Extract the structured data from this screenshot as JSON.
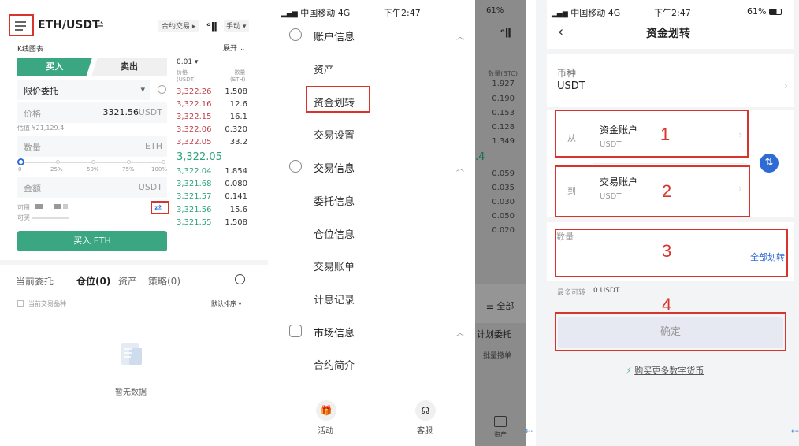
{
  "panel1": {
    "pair": "ETH/USDT",
    "contract_label": "合约交易",
    "manual_label": "手动",
    "kline_label": "K线图表",
    "expand_label": "展开",
    "buy_tab": "买入",
    "sell_tab": "卖出",
    "order_type": "限价委托",
    "price_label": "价格",
    "price_value": "3321.56",
    "price_unit": "USDT",
    "estimate": "估值 ¥21,129.4",
    "qty_label": "数量",
    "qty_unit": "ETH",
    "slider_marks": [
      "0",
      "25%",
      "50%",
      "75%",
      "100%"
    ],
    "amount_label": "金额",
    "amount_unit": "USDT",
    "available_label": "可用",
    "buyable_label": "可买",
    "buy_button": "买入 ETH",
    "ob_precision": "0.01",
    "ob_price_header": "价格\n(USDT)",
    "ob_qty_header": "数量\n(ETH)",
    "asks": [
      {
        "p": "3,322.26",
        "q": "1.508"
      },
      {
        "p": "3,322.16",
        "q": "12.6"
      },
      {
        "p": "3,322.15",
        "q": "16.1"
      },
      {
        "p": "3,322.06",
        "q": "0.320"
      },
      {
        "p": "3,322.05",
        "q": "33.2"
      }
    ],
    "last_price": "3,322.05",
    "bids": [
      {
        "p": "3,322.04",
        "q": "1.854"
      },
      {
        "p": "3,321.68",
        "q": "0.080"
      },
      {
        "p": "3,321.57",
        "q": "0.141"
      },
      {
        "p": "3,321.56",
        "q": "15.6"
      },
      {
        "p": "3,321.55",
        "q": "1.508"
      }
    ],
    "tabs": [
      "当前委托",
      "仓位(0)",
      "资产",
      "策略(0)"
    ],
    "current_pair_only": "当前交易品种",
    "sort_label": "默认排序",
    "empty_text": "暂无数据"
  },
  "panel2": {
    "carrier": "中国移动",
    "network": "4G",
    "time": "下午2:47",
    "battery": "61%",
    "sections": [
      {
        "title": "账户信息",
        "items": [
          "资产",
          "资金划转",
          "交易设置"
        ]
      },
      {
        "title": "交易信息",
        "items": [
          "委托信息",
          "仓位信息",
          "交易账单",
          "计息记录"
        ]
      },
      {
        "title": "市场信息",
        "items": [
          "合约简介"
        ]
      }
    ],
    "bottom": [
      "活动",
      "客服"
    ],
    "overlay": {
      "header": "数量(BTC)",
      "rows_top": [
        "1.927",
        "0.190",
        "0.153",
        "0.128",
        "1.349"
      ],
      "rows_bottom": [
        "0.059",
        "0.035",
        "0.030",
        "0.050",
        "0.020"
      ],
      "mid": ".4",
      "all": "全部",
      "plan": "计划委托",
      "batch": "批量撤单",
      "assets": "资产"
    }
  },
  "panel3": {
    "carrier": "中国移动",
    "network": "4G",
    "time": "下午2:47",
    "battery": "61%",
    "title": "资金划转",
    "coin_label": "币种",
    "coin_value": "USDT",
    "from_label": "从",
    "from_account": "资金账户",
    "from_unit": "USDT",
    "to_label": "到",
    "to_account": "交易账户",
    "to_unit": "USDT",
    "qty_label": "数量",
    "transfer_all": "全部划转",
    "max_label": "最多可转",
    "max_value": "0 USDT",
    "confirm": "确定",
    "buy_more": "购买更多数字货币",
    "step_nums": [
      "1",
      "2",
      "3",
      "4"
    ]
  }
}
